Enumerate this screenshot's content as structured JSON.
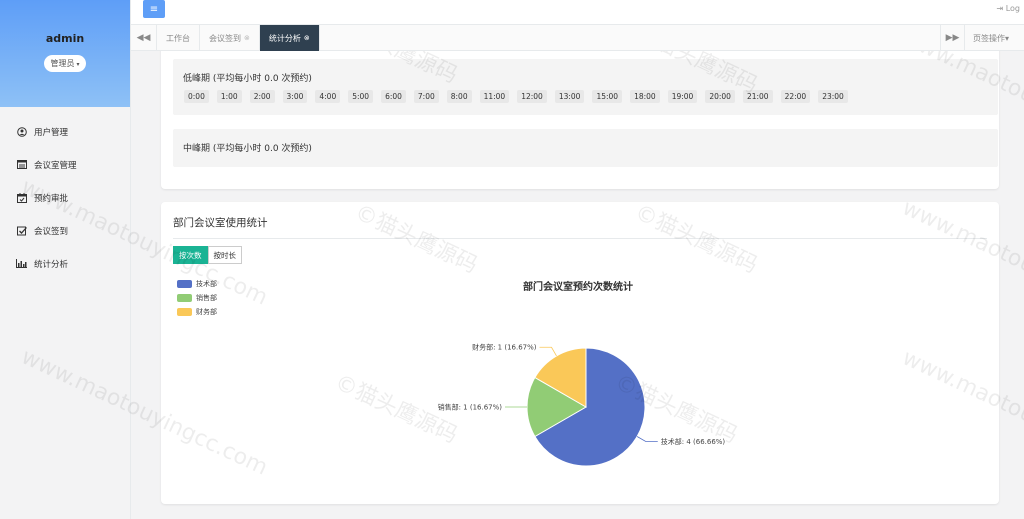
{
  "sidebar": {
    "user_name": "admin",
    "role": "管理员",
    "items": [
      {
        "label": "用户管理",
        "icon": "user-icon"
      },
      {
        "label": "会议室管理",
        "icon": "list-icon"
      },
      {
        "label": "预约审批",
        "icon": "calendar-icon"
      },
      {
        "label": "会议签到",
        "icon": "checkbox-icon"
      },
      {
        "label": "统计分析",
        "icon": "bar-chart-icon"
      }
    ]
  },
  "topbar": {
    "logout_label": "Log"
  },
  "tabs": [
    {
      "label": "工作台",
      "closable": false
    },
    {
      "label": "会议签到",
      "closable": true
    },
    {
      "label": "统计分析",
      "closable": true,
      "active": true
    }
  ],
  "tab_ops_label": "页签操作",
  "periods": {
    "low": {
      "title": "低峰期 (平均每小时 0.0 次预约)",
      "hours": [
        "0:00",
        "1:00",
        "2:00",
        "3:00",
        "4:00",
        "5:00",
        "6:00",
        "7:00",
        "8:00",
        "11:00",
        "12:00",
        "13:00",
        "15:00",
        "18:00",
        "19:00",
        "20:00",
        "21:00",
        "22:00",
        "23:00"
      ]
    },
    "mid": {
      "title": "中峰期 (平均每小时 0.0 次预约)"
    }
  },
  "dept_card": {
    "title": "部门会议室使用统计",
    "btn_count": "按次数",
    "btn_duration": "按时长"
  },
  "chart_data": {
    "type": "pie",
    "title": "部门会议室预约次数统计",
    "legend_position": "top-left",
    "slices": [
      {
        "name": "技术部",
        "value": 4,
        "percent": 66.66,
        "label": "技术部: 4 (66.66%)",
        "color": "#5470c6"
      },
      {
        "name": "销售部",
        "value": 1,
        "percent": 16.67,
        "label": "销售部: 1 (16.67%)",
        "color": "#91cc75"
      },
      {
        "name": "财务部",
        "value": 1,
        "percent": 16.67,
        "label": "财务部: 1 (16.67%)",
        "color": "#fac858"
      }
    ]
  }
}
